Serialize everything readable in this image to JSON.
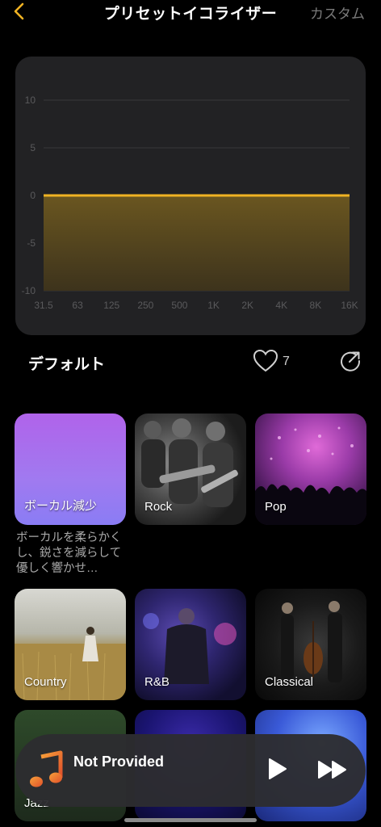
{
  "header": {
    "title": "プリセットイコライザー",
    "custom_label": "カスタム"
  },
  "chart_data": {
    "type": "area",
    "x": [
      "31.5",
      "63",
      "125",
      "250",
      "500",
      "1K",
      "2K",
      "4K",
      "8K",
      "16K"
    ],
    "values": [
      0,
      0,
      0,
      0,
      0,
      0,
      0,
      0,
      0,
      0
    ],
    "yticks": [
      "10",
      "5",
      "0",
      "-5",
      "-10"
    ],
    "ylim": [
      -10,
      10
    ],
    "grid": true,
    "colors": {
      "line": "#f0b323",
      "fill_top": "#6a5620",
      "fill_bottom": "#3d331c"
    }
  },
  "preset": {
    "name": "デフォルト",
    "likes": "7"
  },
  "tiles": [
    {
      "label": "ボーカル減少",
      "desc": "ボーカルを柔らかくし、鋭さを減らして優しく響かせ…"
    },
    {
      "label": "Rock"
    },
    {
      "label": "Pop"
    },
    {
      "label": "Country"
    },
    {
      "label": "R&B"
    },
    {
      "label": "Classical"
    },
    {
      "label": "Jazz"
    }
  ],
  "player": {
    "title": "Not Provided"
  }
}
